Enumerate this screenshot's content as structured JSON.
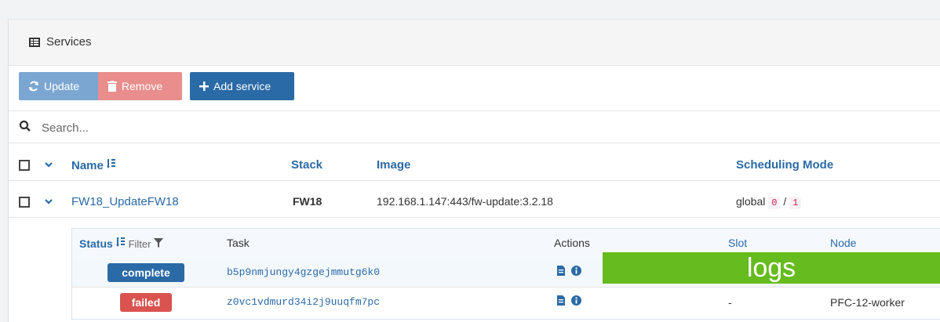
{
  "panel": {
    "title": "Services"
  },
  "toolbar": {
    "update_label": "Update",
    "remove_label": "Remove",
    "add_label": "Add service"
  },
  "search": {
    "placeholder": "Search..."
  },
  "table": {
    "headers": {
      "name": "Name",
      "stack": "Stack",
      "image": "Image",
      "scheduling": "Scheduling Mode"
    },
    "service": {
      "name": "FW18_UpdateFW18",
      "stack": "FW18",
      "image": "192.168.1.147:443/fw-update:3.2.18",
      "mode": "global",
      "running": "0",
      "separator": "/",
      "desired": "1"
    }
  },
  "tasks": {
    "headers": {
      "status": "Status",
      "filter": "Filter",
      "task": "Task",
      "actions": "Actions",
      "slot": "Slot",
      "node": "Node"
    },
    "rows": [
      {
        "status": "complete",
        "task": "b5p9nmjungy4gzgejmmutg6k0",
        "slot": "",
        "node": ""
      },
      {
        "status": "failed",
        "task": "z0vc1vdmurd34i2j9uuqfm7pc",
        "slot": "-",
        "node": "PFC-12-worker"
      }
    ]
  },
  "overlay": {
    "text": "logs"
  },
  "colors": {
    "primary": "#2a6aa6",
    "danger": "#d9534f",
    "overlay": "#66bb1e"
  }
}
